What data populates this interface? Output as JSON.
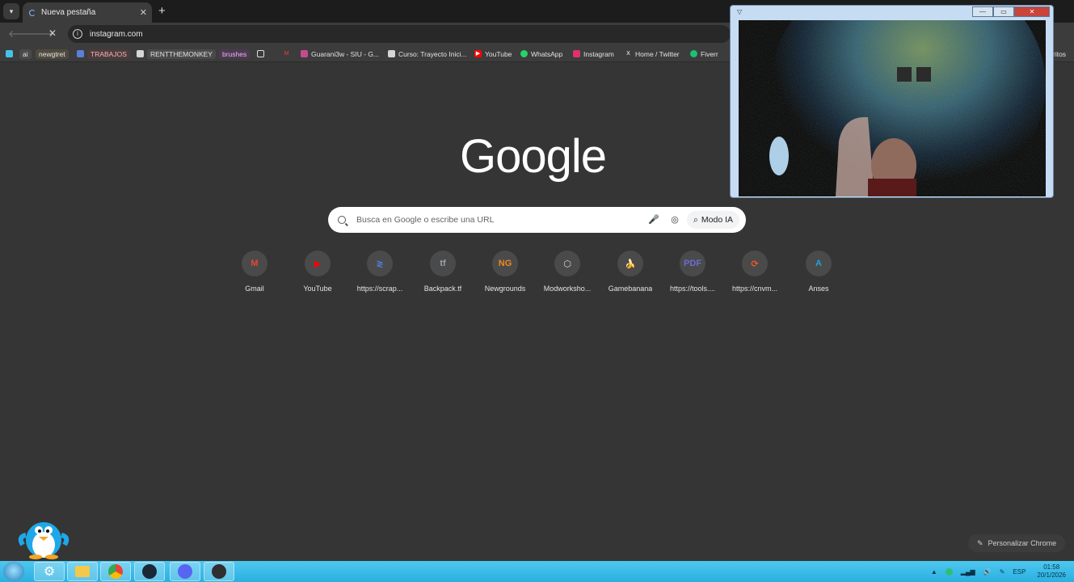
{
  "browser": {
    "tab": {
      "title": "Nueva pestaña",
      "close": "✕"
    },
    "new_tab": "+",
    "menu_icon": "chevron-down",
    "url": "instagram.com",
    "bookmarks": [
      {
        "label": "ai",
        "color": "#44a0d8"
      },
      {
        "label": "newgtret",
        "color": "#7a5c2e"
      },
      {
        "label": "TRABAJOS",
        "color": "#5b7fd9"
      },
      {
        "label": "RENTTHEMONKEY",
        "color": "#cfcfcf"
      },
      {
        "label": "brushes",
        "color": "#5b3a6e"
      },
      {
        "label": "Guarani3w - SIU - G...",
        "color": "#c64b8c"
      },
      {
        "label": "Curso: Trayecto Inici...",
        "color": "#d6d6d6"
      },
      {
        "label": "YouTube",
        "color": "#ff0000"
      },
      {
        "label": "WhatsApp",
        "color": "#25d366"
      },
      {
        "label": "Instagram",
        "color": "#e1306c"
      },
      {
        "label": "Home / Twitter",
        "color": "#000000"
      },
      {
        "label": "Fiverr",
        "color": "#1dbf73"
      }
    ],
    "bookmarks_overflow": "ritos"
  },
  "ntp": {
    "logo": "Google",
    "search_placeholder": "Busca en Google o escribe una URL",
    "modo_ia": "Modo IA",
    "customize": "Personalizar Chrome",
    "shortcuts": [
      {
        "label": "Gmail",
        "glyph": "M",
        "color": "#ea4335"
      },
      {
        "label": "YouTube",
        "glyph": "▶",
        "color": "#ff0000"
      },
      {
        "label": "https://scrap...",
        "glyph": "≷",
        "color": "#4e7fe0"
      },
      {
        "label": "Backpack.tf",
        "glyph": "tf",
        "color": "#9aa4ad"
      },
      {
        "label": "Newgrounds",
        "glyph": "NG",
        "color": "#f08a1c"
      },
      {
        "label": "Modworksho...",
        "glyph": "⬡",
        "color": "#dddddd"
      },
      {
        "label": "Gamebanana",
        "glyph": "🍌",
        "color": "#f3d33c"
      },
      {
        "label": "https://tools....",
        "glyph": "PDF",
        "color": "#6b6bd6"
      },
      {
        "label": "https://cnvm...",
        "glyph": "⟳",
        "color": "#f05a28"
      },
      {
        "label": "Anses",
        "glyph": "A",
        "color": "#1da1e0"
      }
    ]
  },
  "webcam": {
    "title_arrow": "▽",
    "min": "—",
    "max": "▭",
    "close": "✕"
  },
  "taskbar": {
    "apps": [
      "gear-app",
      "file-explorer",
      "chrome",
      "steam",
      "discord",
      "obs"
    ],
    "tray": {
      "lang": "ESP",
      "time": "01:58",
      "date": "20/1/2026"
    }
  }
}
